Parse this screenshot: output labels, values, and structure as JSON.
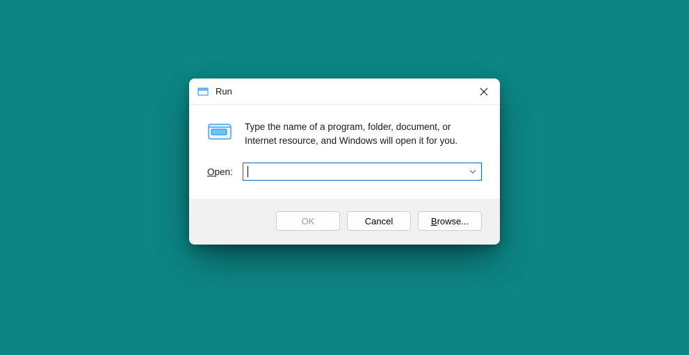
{
  "dialog": {
    "title": "Run",
    "description": "Type the name of a program, folder, document, or Internet resource, and Windows will open it for you.",
    "open_label_pre": "O",
    "open_label_post": "pen:",
    "input_value": "",
    "input_placeholder": "",
    "buttons": {
      "ok": "OK",
      "cancel": "Cancel",
      "browse_pre": "B",
      "browse_post": "rowse..."
    }
  }
}
